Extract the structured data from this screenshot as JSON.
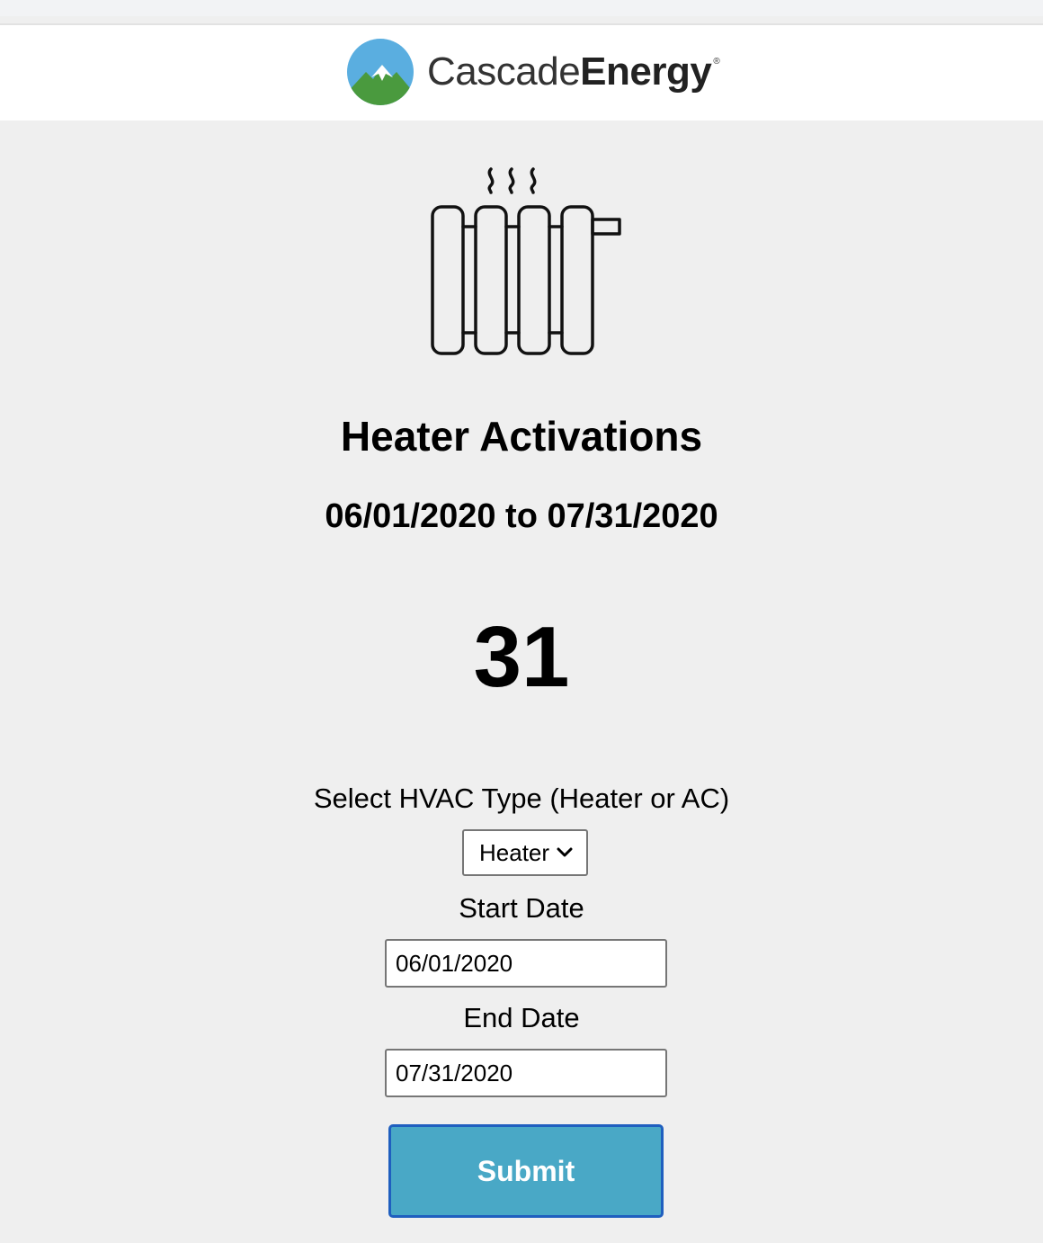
{
  "brand": {
    "name_light": "Cascade",
    "name_bold": "Energy",
    "registered_mark": "®",
    "logo_colors": {
      "sky": "#5aaee0",
      "mountain": "#4a9a3e",
      "snow": "#ffffff"
    }
  },
  "hero": {
    "icon": "radiator-icon",
    "title": "Heater Activations",
    "date_range": "06/01/2020 to 07/31/2020",
    "count": "31"
  },
  "form": {
    "hvac_label": "Select HVAC Type (Heater or AC)",
    "hvac_selected": "Heater",
    "start_label": "Start Date",
    "start_value": "06/01/2020",
    "end_label": "End Date",
    "end_value": "07/31/2020",
    "submit_label": "Submit"
  },
  "colors": {
    "page_background": "#efefef",
    "header_background": "#ffffff",
    "submit_background": "#49a8c6",
    "submit_border": "#1f5fbf"
  }
}
